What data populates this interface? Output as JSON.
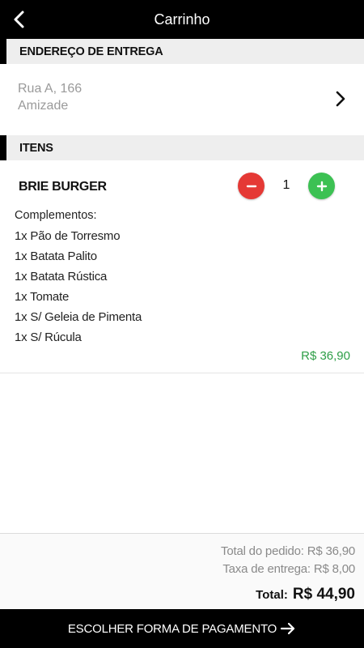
{
  "header": {
    "title": "Carrinho"
  },
  "delivery": {
    "section_title": "ENDEREÇO DE ENTREGA",
    "street": "Rua A, 166",
    "neighborhood": "Amizade"
  },
  "items_section": {
    "title": "ITENS"
  },
  "items": [
    {
      "name": "BRIE BURGER",
      "quantity": "1",
      "complements_title": "Complementos:",
      "complements": [
        "1x Pão de Torresmo",
        "1x Batata Palito",
        "1x Batata Rústica",
        "1x Tomate",
        "1x S/ Geleia de Pimenta",
        "1x S/ Rúcula"
      ],
      "price": "R$ 36,90"
    }
  ],
  "summary": {
    "order_total": "Total do pedido: R$ 36,90",
    "delivery_fee": "Taxa de entrega: R$ 8,00",
    "total_label": "Total:",
    "total_value": "R$ 44,90"
  },
  "footer": {
    "pay_button": "ESCOLHER FORMA DE PAGAMENTO"
  },
  "colors": {
    "bar": "#000000",
    "section_bg": "#eeeeee",
    "minus": "#e53935",
    "plus": "#3cc153",
    "price": "#2e9e47"
  },
  "icons": {
    "back": "chevron-left-icon",
    "address_arrow": "chevron-right-icon",
    "minus": "minus-icon",
    "plus": "plus-icon",
    "pay_arrow": "arrow-right-icon"
  }
}
